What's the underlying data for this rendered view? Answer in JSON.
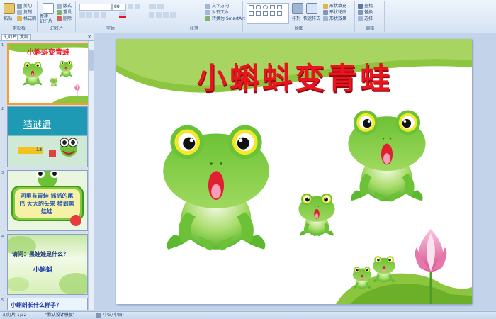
{
  "ribbon": {
    "clipboard": {
      "paste": "粘贴",
      "cut": "剪切",
      "copy": "复制",
      "format_painter": "格式刷",
      "label": "剪贴板"
    },
    "slides": {
      "new_slide": "新建\n幻灯片",
      "layout": "版式",
      "reset": "重设",
      "delete": "删除",
      "label": "幻灯片"
    },
    "font": {
      "size_value": "88",
      "label": "字体"
    },
    "paragraph": {
      "text_direction": "文字方向",
      "align_text": "对齐文本",
      "smartart": "转换为 SmartArt",
      "label": "段落"
    },
    "drawing": {
      "arrange": "排列",
      "quick_styles": "快速样式",
      "shape_fill": "形状填充",
      "shape_outline": "形状轮廓",
      "shape_effects": "形状效果",
      "label": "绘图"
    },
    "editing": {
      "find": "查找",
      "replace": "替换",
      "select": "选择",
      "label": "编辑"
    }
  },
  "pane": {
    "tabs": [
      "幻灯片",
      "大纲"
    ],
    "close": "×",
    "slides": [
      {
        "number": "1",
        "title": "小蝌蚪变青蛙"
      },
      {
        "number": "2",
        "title": "猜谜语",
        "badge": "13"
      },
      {
        "number": "3",
        "title": "河里有青蛙 摇摇的尾巴 大大的头来 猜到黑娃娃"
      },
      {
        "number": "4",
        "title": "请问：黑娃娃是什么？",
        "subtitle": "小蝌蚪"
      },
      {
        "number": "5",
        "title": "小蝌蚪长什么样子？"
      }
    ]
  },
  "slide": {
    "title": "小蝌蚪变青蛙"
  },
  "status": {
    "slide_counter": "幻灯片 1/32",
    "theme": "\"默认设计模板\"",
    "language": "中文(中国)"
  },
  "colors": {
    "accent_red": "#e8141e",
    "frog_green": "#5cb82e",
    "ribbon_blue": "#d6e3f3"
  }
}
